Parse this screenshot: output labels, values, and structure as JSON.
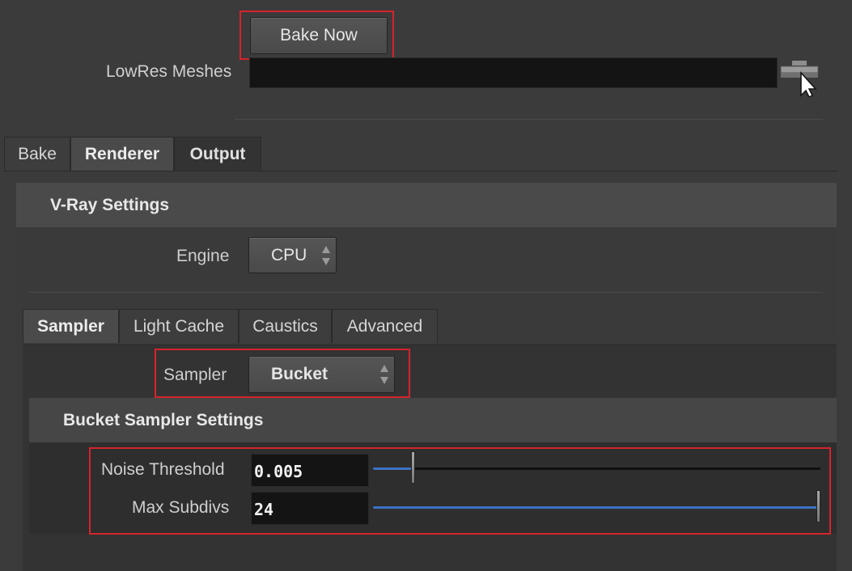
{
  "top": {
    "bake_button": "Bake Now",
    "lowres_label": "LowRes Meshes",
    "lowres_value": ""
  },
  "main_tabs": [
    {
      "label": "Bake"
    },
    {
      "label": "Renderer"
    },
    {
      "label": "Output"
    }
  ],
  "vray": {
    "header": "V-Ray Settings",
    "engine_label": "Engine",
    "engine_value": "CPU"
  },
  "sub_tabs": [
    {
      "label": "Sampler"
    },
    {
      "label": "Light Cache"
    },
    {
      "label": "Caustics"
    },
    {
      "label": "Advanced"
    }
  ],
  "sampler": {
    "label": "Sampler",
    "value": "Bucket"
  },
  "bucket": {
    "header": "Bucket Sampler Settings",
    "noise_label": "Noise Threshold",
    "noise_value": "0.005",
    "noise_slider_fraction": 0.09,
    "subdivs_label": "Max Subdivs",
    "subdivs_value": "24",
    "subdivs_slider_fraction": 1.0
  },
  "colors": {
    "highlight": "#d6232c",
    "slider_fill": "#3b73c4"
  }
}
